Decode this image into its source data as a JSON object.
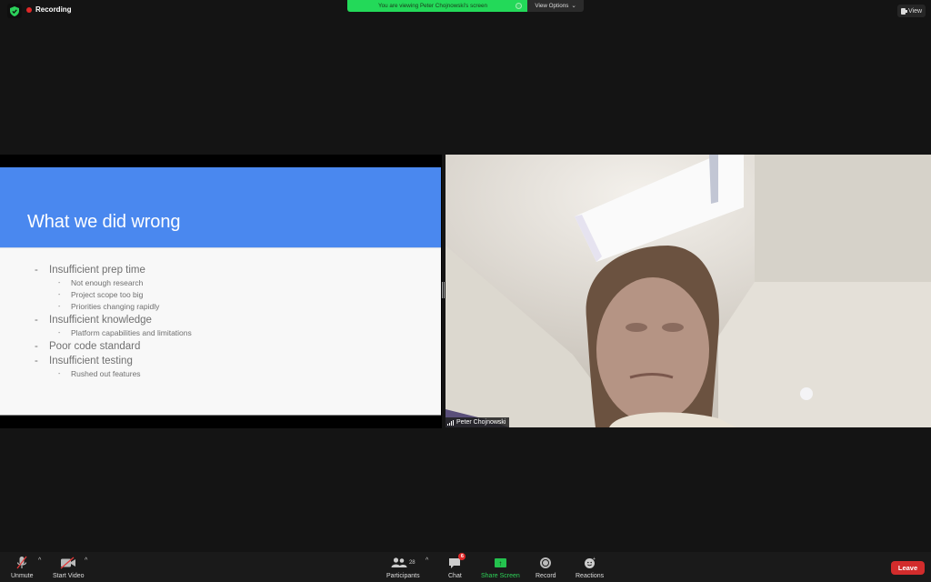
{
  "top_bar": {
    "security_icon": "shield-check-icon",
    "recording_label": "Recording",
    "recording_color": "#e02828",
    "share_banner_text": "You are viewing Peter Chojnowski's screen",
    "share_banner_color": "#23d959",
    "view_options_label": "View Options",
    "view_button_label": "View"
  },
  "slide": {
    "title": "What we did wrong",
    "header_color": "#4a88ef",
    "items": [
      {
        "level": 1,
        "text": "Insufficient prep time"
      },
      {
        "level": 2,
        "text": "Not enough research"
      },
      {
        "level": 2,
        "text": "Project scope too big"
      },
      {
        "level": 2,
        "text": "Priorities changing rapidly"
      },
      {
        "level": 1,
        "text": "Insufficient knowledge"
      },
      {
        "level": 2,
        "text": "Platform capabilities and limitations"
      },
      {
        "level": 1,
        "text": "Poor code standard"
      },
      {
        "level": 1,
        "text": "Insufficient testing"
      },
      {
        "level": 2,
        "text": "Rushed out features"
      }
    ]
  },
  "video": {
    "participant_name": "Peter Chojnowski"
  },
  "toolbar": {
    "unmute_label": "Unmute",
    "start_video_label": "Start Video",
    "participants_label": "Participants",
    "participants_count": "28",
    "chat_label": "Chat",
    "chat_badge": "6",
    "share_screen_label": "Share Screen",
    "record_label": "Record",
    "reactions_label": "Reactions",
    "leave_label": "Leave",
    "leave_color": "#d22c2c"
  }
}
